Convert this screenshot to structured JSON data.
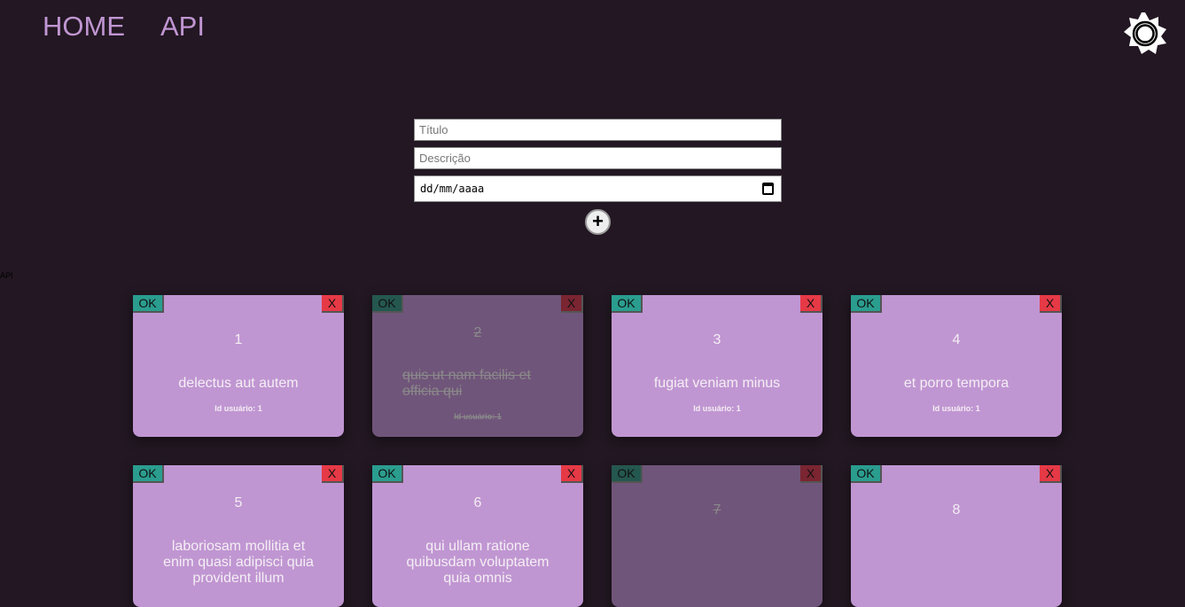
{
  "nav": {
    "home": "HOME",
    "api": "API"
  },
  "form": {
    "title_placeholder": "Título",
    "description_placeholder": "Descrição",
    "date_placeholder": "dd/mm/aaaa",
    "add_label": "+"
  },
  "side_label": "API",
  "todos": [
    {
      "id": "1",
      "title": "delectus aut autem",
      "user": "Id usuário: 1",
      "completed": false
    },
    {
      "id": "2",
      "title": "quis ut nam facilis et officia qui",
      "user": "Id usuário: 1",
      "completed": true
    },
    {
      "id": "3",
      "title": "fugiat veniam minus",
      "user": "Id usuário: 1",
      "completed": false
    },
    {
      "id": "4",
      "title": "et porro tempora",
      "user": "Id usuário: 1",
      "completed": false
    },
    {
      "id": "5",
      "title": "laboriosam mollitia et enim quasi adipisci quia provident illum",
      "completed": false
    },
    {
      "id": "6",
      "title": "qui ullam ratione quibusdam voluptatem quia omnis",
      "completed": false
    },
    {
      "id": "7",
      "completed": true
    },
    {
      "id": "8",
      "completed": false
    }
  ],
  "buttons": {
    "ok": "OK",
    "delete": "X"
  }
}
